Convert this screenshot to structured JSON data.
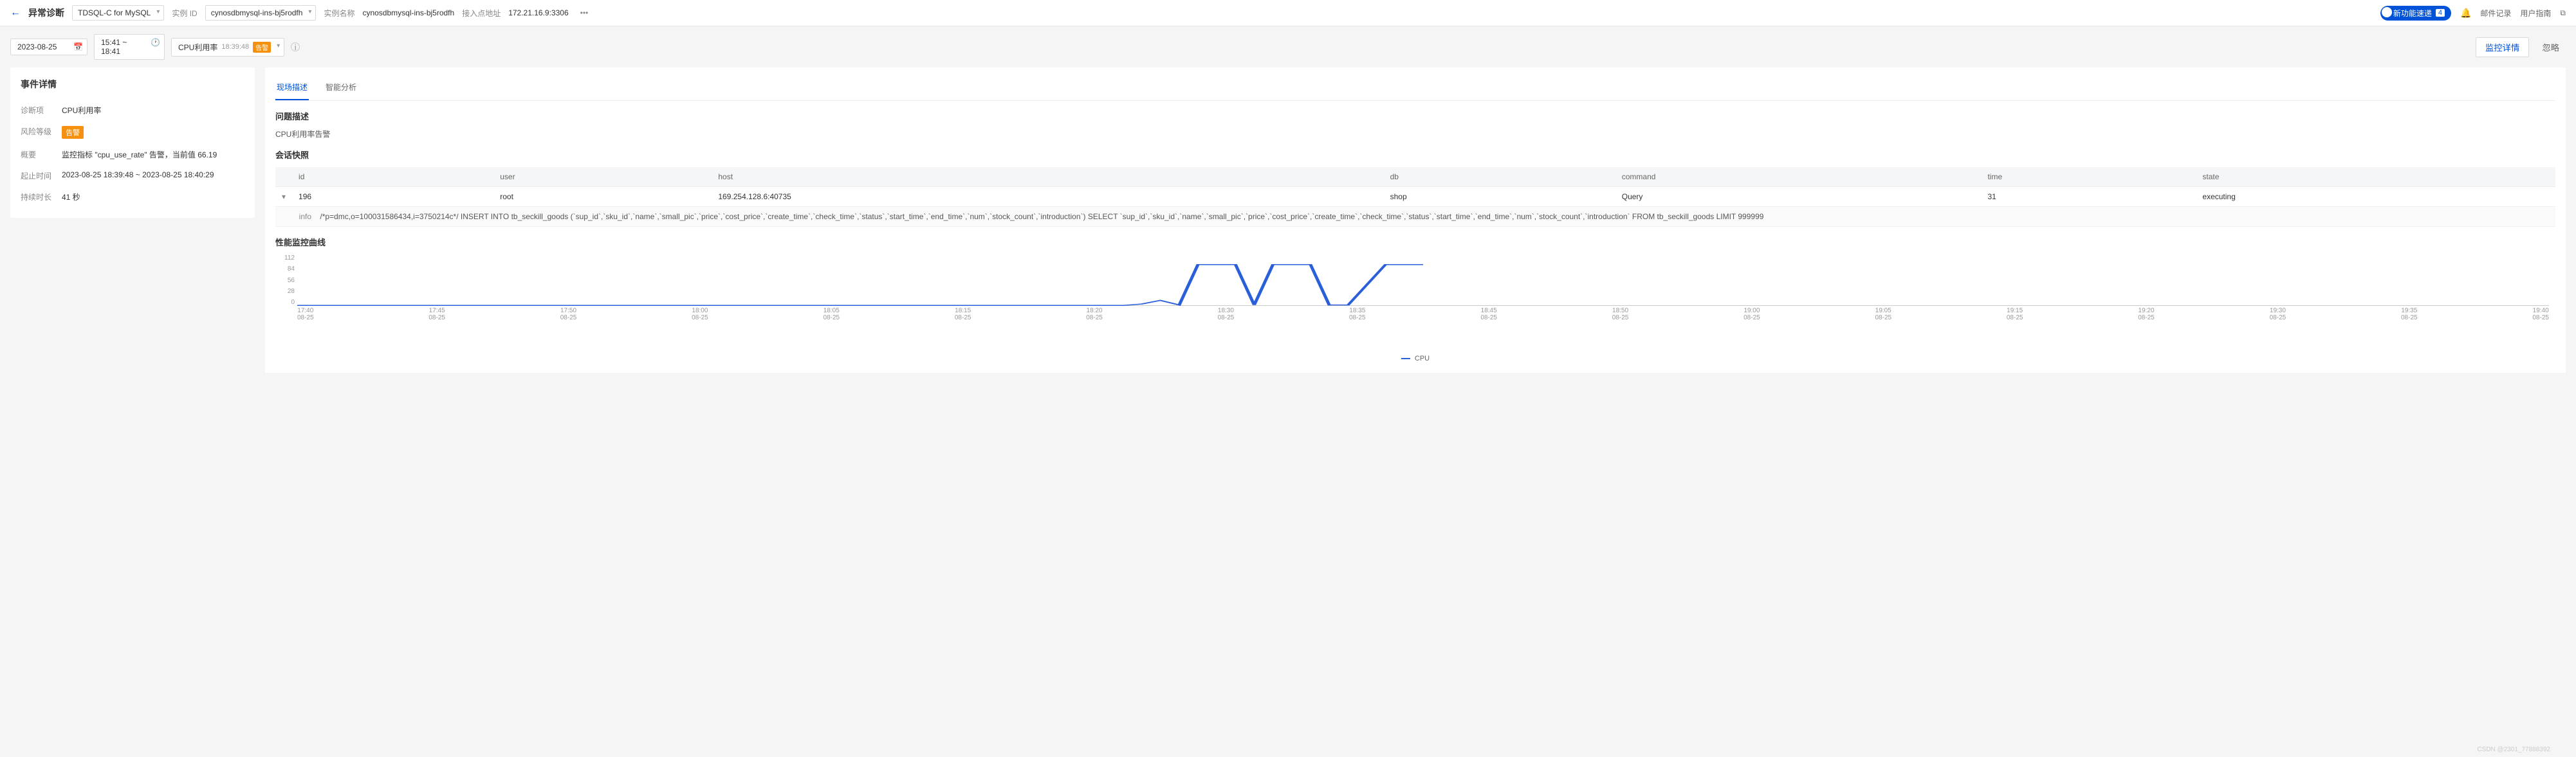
{
  "header": {
    "page_title": "异常诊断",
    "product_dropdown": "TDSQL-C for MySQL",
    "instance_id_label": "实例 ID",
    "instance_id_value": "cynosdbmysql-ins-bj5rodfh",
    "instance_name_label": "实例名称",
    "instance_name_value": "cynosdbmysql-ins-bj5rodfh",
    "endpoint_label": "接入点地址",
    "endpoint_value": "172.21.16.9:3306",
    "feature_badge": "新功能速递",
    "feature_count": "4",
    "mail_log": "邮件记录",
    "user_guide": "用户指南"
  },
  "toolbar": {
    "date": "2023-08-25",
    "time_range": "15:41 ~ 18:41",
    "metric_name": "CPU利用率",
    "metric_time": "18:39:48",
    "alert_tag": "告警",
    "btn_detail": "监控详情",
    "btn_ignore": "忽略"
  },
  "event_detail": {
    "title": "事件详情",
    "rows": {
      "diagnosis_label": "诊断项",
      "diagnosis_value": "CPU利用率",
      "risk_label": "风险等级",
      "risk_value": "告警",
      "summary_label": "概要",
      "summary_value": "监控指标 \"cpu_use_rate\" 告警，当前值 66.19",
      "time_label": "起止时间",
      "time_value": "2023-08-25 18:39:48 ~ 2023-08-25 18:40:29",
      "duration_label": "持续时长",
      "duration_value": "41 秒"
    }
  },
  "right_panel": {
    "tabs": {
      "live": "现场描述",
      "smart": "智能分析"
    },
    "problem_title": "问题描述",
    "problem_desc": "CPU利用率告警",
    "session_title": "会话快照",
    "table": {
      "cols": {
        "id": "id",
        "user": "user",
        "host": "host",
        "db": "db",
        "command": "command",
        "time": "time",
        "state": "state"
      },
      "row": {
        "id": "196",
        "user": "root",
        "host": "169.254.128.6:40735",
        "db": "shop",
        "command": "Query",
        "time": "31",
        "state": "executing"
      },
      "info_label": "info",
      "info_value": "/*p=dmc,o=100031586434,i=3750214c*/ INSERT INTO tb_seckill_goods (`sup_id`,`sku_id`,`name`,`small_pic`,`price`,`cost_price`,`create_time`,`check_time`,`status`,`start_time`,`end_time`,`num`,`stock_count`,`introduction`) SELECT `sup_id`,`sku_id`,`name`,`small_pic`,`price`,`cost_price`,`create_time`,`check_time`,`status`,`start_time`,`end_time`,`num`,`stock_count`,`introduction` FROM tb_seckill_goods LIMIT 999999"
    },
    "perf_title": "性能监控曲线",
    "legend": "CPU"
  },
  "chart_data": {
    "type": "line",
    "title": "性能监控曲线",
    "ylabel": "",
    "xlabel": "",
    "ylim": [
      0,
      112
    ],
    "y_ticks": [
      112,
      84,
      56,
      28,
      0
    ],
    "x_ticks": [
      "17:40",
      "17:45",
      "17:50",
      "18:00",
      "18:05",
      "18:15",
      "18:20",
      "18:30",
      "18:35",
      "18:45",
      "18:50",
      "19:00",
      "19:05",
      "19:15",
      "19:20",
      "19:30",
      "19:35",
      "19:40"
    ],
    "x_date": "08-25",
    "series": [
      {
        "name": "CPU",
        "color": "#2b5fd9",
        "points": [
          {
            "x": "17:40",
            "y": 1
          },
          {
            "x": "17:45",
            "y": 1
          },
          {
            "x": "17:50",
            "y": 1
          },
          {
            "x": "18:00",
            "y": 1
          },
          {
            "x": "18:05",
            "y": 1
          },
          {
            "x": "18:15",
            "y": 1
          },
          {
            "x": "18:20",
            "y": 1
          },
          {
            "x": "18:24",
            "y": 1
          },
          {
            "x": "18:25",
            "y": 4
          },
          {
            "x": "18:26",
            "y": 12
          },
          {
            "x": "18:27",
            "y": 2
          },
          {
            "x": "18:28",
            "y": 90
          },
          {
            "x": "18:30",
            "y": 90
          },
          {
            "x": "18:31",
            "y": 2
          },
          {
            "x": "18:32",
            "y": 90
          },
          {
            "x": "18:34",
            "y": 90
          },
          {
            "x": "18:35",
            "y": 2
          },
          {
            "x": "18:36",
            "y": 2
          },
          {
            "x": "18:38",
            "y": 90
          },
          {
            "x": "18:40",
            "y": 90
          }
        ]
      }
    ]
  },
  "watermark": "CSDN @2301_77888392"
}
